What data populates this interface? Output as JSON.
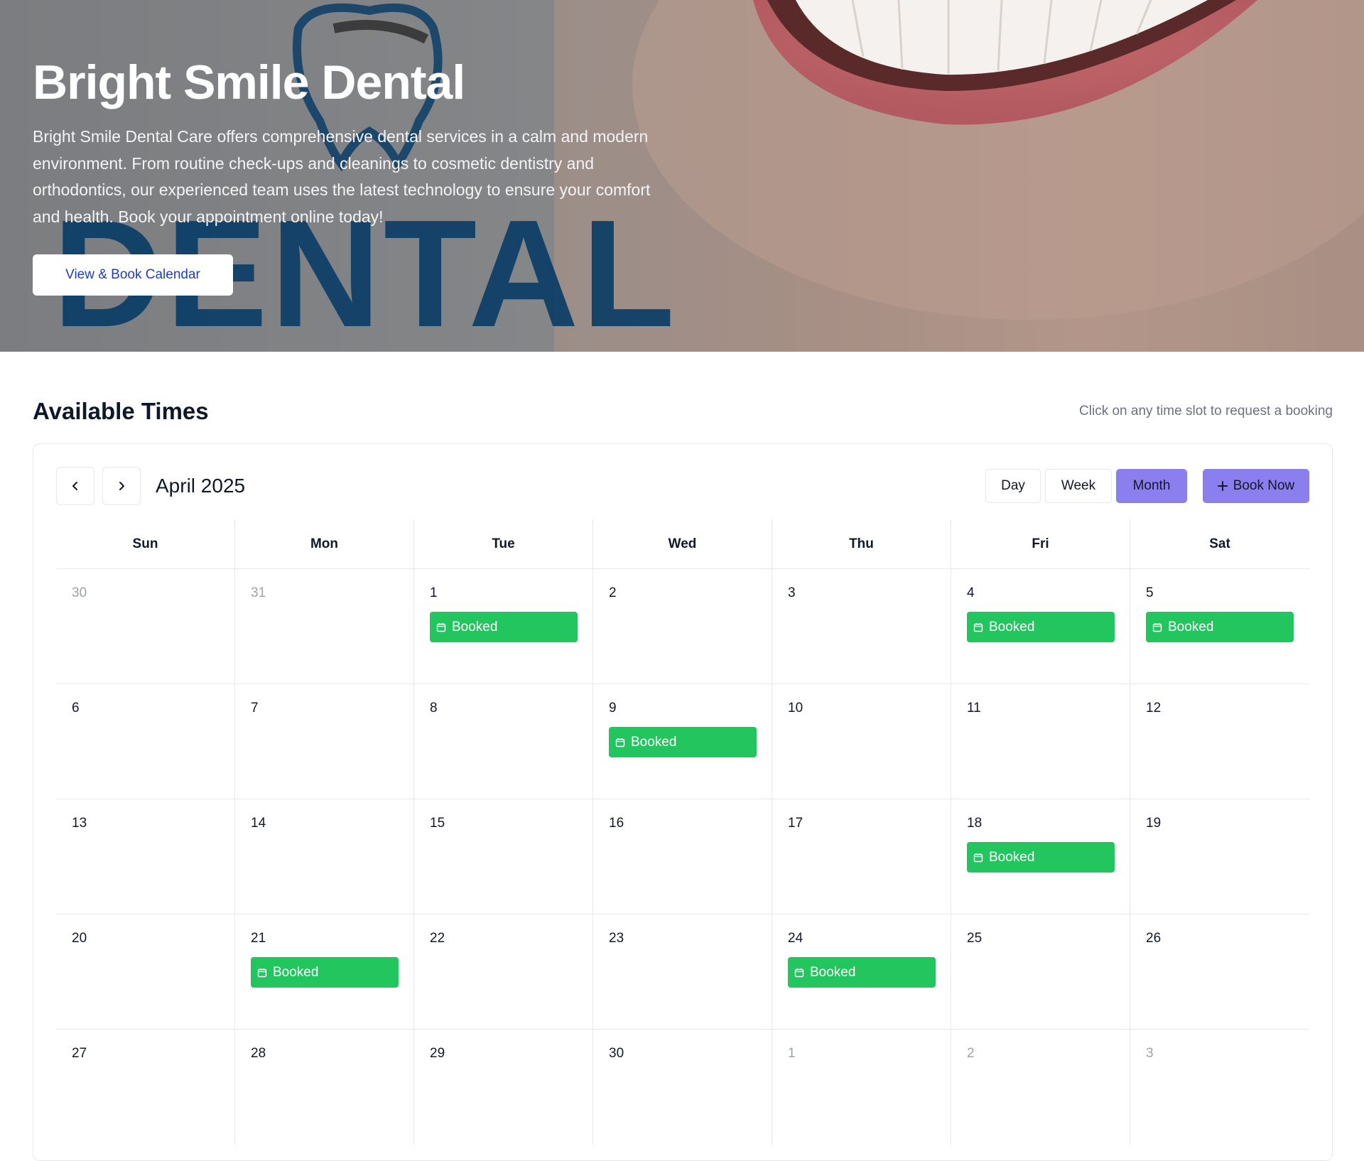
{
  "hero": {
    "title": "Bright Smile Dental",
    "description": "Bright Smile Dental Care offers comprehensive dental services in a calm and modern environment. From routine check-ups and cleanings to cosmetic dentistry and orthodontics, our experienced team uses the latest technology to ensure your comfort and health. Book your appointment online today!",
    "cta_label": "View & Book Calendar",
    "background_wordmark": "DENTAL"
  },
  "section": {
    "title": "Available Times",
    "hint": "Click on any time slot to request a booking"
  },
  "calendar": {
    "month_label": "April 2025",
    "prev_icon": "chevron-left-icon",
    "next_icon": "chevron-right-icon",
    "views": {
      "day": "Day",
      "week": "Week",
      "month": "Month",
      "active": "month"
    },
    "book_now_label": "Book Now",
    "booked_label": "Booked",
    "weekdays": [
      "Sun",
      "Mon",
      "Tue",
      "Wed",
      "Thu",
      "Fri",
      "Sat"
    ],
    "weeks": [
      [
        {
          "day": "30",
          "muted": true,
          "booked": false
        },
        {
          "day": "31",
          "muted": true,
          "booked": false
        },
        {
          "day": "1",
          "muted": false,
          "booked": true
        },
        {
          "day": "2",
          "muted": false,
          "booked": false
        },
        {
          "day": "3",
          "muted": false,
          "booked": false
        },
        {
          "day": "4",
          "muted": false,
          "booked": true
        },
        {
          "day": "5",
          "muted": false,
          "booked": true
        }
      ],
      [
        {
          "day": "6",
          "muted": false,
          "booked": false
        },
        {
          "day": "7",
          "muted": false,
          "booked": false
        },
        {
          "day": "8",
          "muted": false,
          "booked": false
        },
        {
          "day": "9",
          "muted": false,
          "booked": true
        },
        {
          "day": "10",
          "muted": false,
          "booked": false
        },
        {
          "day": "11",
          "muted": false,
          "booked": false
        },
        {
          "day": "12",
          "muted": false,
          "booked": false
        }
      ],
      [
        {
          "day": "13",
          "muted": false,
          "booked": false
        },
        {
          "day": "14",
          "muted": false,
          "booked": false
        },
        {
          "day": "15",
          "muted": false,
          "booked": false
        },
        {
          "day": "16",
          "muted": false,
          "booked": false
        },
        {
          "day": "17",
          "muted": false,
          "booked": false
        },
        {
          "day": "18",
          "muted": false,
          "booked": true
        },
        {
          "day": "19",
          "muted": false,
          "booked": false
        }
      ],
      [
        {
          "day": "20",
          "muted": false,
          "booked": false
        },
        {
          "day": "21",
          "muted": false,
          "booked": true
        },
        {
          "day": "22",
          "muted": false,
          "booked": false
        },
        {
          "day": "23",
          "muted": false,
          "booked": false
        },
        {
          "day": "24",
          "muted": false,
          "booked": true
        },
        {
          "day": "25",
          "muted": false,
          "booked": false
        },
        {
          "day": "26",
          "muted": false,
          "booked": false
        }
      ],
      [
        {
          "day": "27",
          "muted": false,
          "booked": false
        },
        {
          "day": "28",
          "muted": false,
          "booked": false
        },
        {
          "day": "29",
          "muted": false,
          "booked": false
        },
        {
          "day": "30",
          "muted": false,
          "booked": false
        },
        {
          "day": "1",
          "muted": true,
          "booked": false
        },
        {
          "day": "2",
          "muted": true,
          "booked": false
        },
        {
          "day": "3",
          "muted": true,
          "booked": false
        }
      ]
    ]
  },
  "colors": {
    "accent": "#8b7ff0",
    "booked": "#22c55e",
    "link": "#1e40af",
    "wordmark": "#0b3d66"
  }
}
